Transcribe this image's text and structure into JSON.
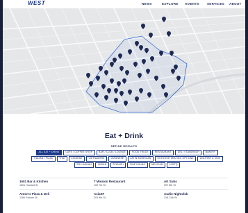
{
  "header": {
    "logo": "WEST",
    "nav": [
      "NEWS",
      "EXPLORE",
      "EVENTS",
      "SERVICES",
      "ABOUT"
    ]
  },
  "page": {
    "title": "Eat + Drink",
    "refine_label": "REFINE RESULTS"
  },
  "filters": [
    "ALL EAT + DRINK",
    "CAFE / COFFEE SHOP",
    "BAR / CLUB / LOUNGE",
    "FOOD TRUCK",
    "RESTAURANT",
    "DELI / SANDWICH",
    "BAKERY",
    "ITALIAN / PIZZA",
    "THAI",
    "CHINESE",
    "VIETNAMESE",
    "JAPANESE",
    "LATIN AMERICAN",
    "OUTDOOR SEATING OPTIONS",
    "LEATHER & KINK",
    "SRI LANKAN",
    "INDIAN",
    "SPANISH",
    "FINE DINING",
    "MEXICAN",
    "LGBTQ"
  ],
  "active_filter": "ALL EAT + DRINK",
  "results": [
    {
      "name": "1601 Bar & Kitchen",
      "address": "1601 Howard St"
    },
    {
      "name": "7 Mission Restaurant",
      "address": "100 7th St"
    },
    {
      "name": "AK Subs",
      "address": "397 8th St"
    },
    {
      "name": "Anton's Pizza & Deli",
      "address": "1196 Folsom St"
    },
    {
      "name": "AsiaSF",
      "address": "201 9th St"
    },
    {
      "name": "Audio Nightclub",
      "address": "316 11th St"
    }
  ],
  "colors": {
    "brand": "#1e3a8a",
    "marker": "#1e2a55",
    "map_bg": "#e7e8ea"
  },
  "map": {
    "marker_icon": "map-pin-icon"
  }
}
